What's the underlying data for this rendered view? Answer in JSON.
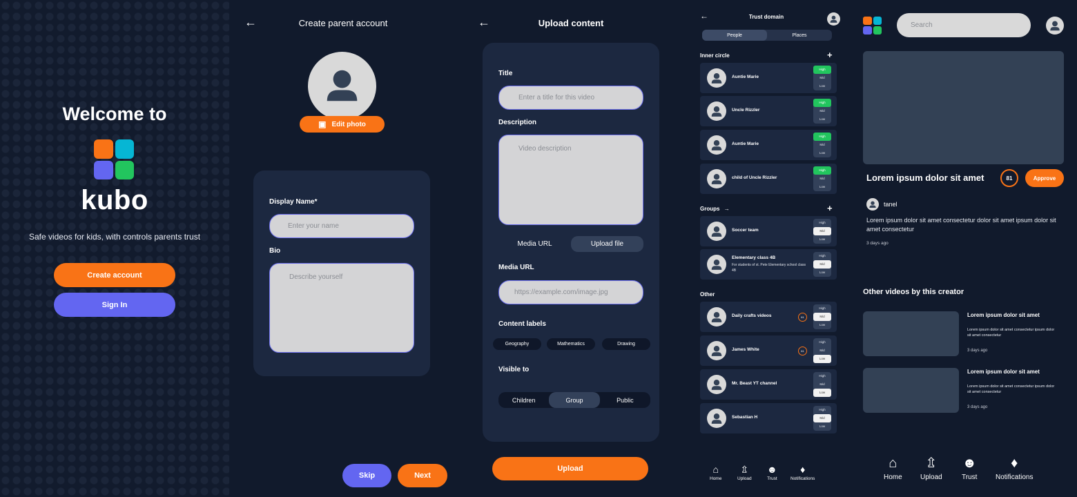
{
  "colors": {
    "bg": "#111a2c",
    "card": "#1c2840",
    "orange": "#f97316",
    "purple": "#6366f1",
    "green": "#22c55e",
    "slate": "#334155"
  },
  "logo_colors": [
    "#f97316",
    "#06b6d4",
    "#6366f1",
    "#22c55e"
  ],
  "welcome": {
    "heading": "Welcome to",
    "brand": "kubo",
    "tagline": "Safe videos for kids, with controls parents trust",
    "create_button": "Create account",
    "signin_button": "Sign In"
  },
  "create_account": {
    "title": "Create parent account",
    "edit_photo": "Edit photo",
    "display_name_label": "Display Name*",
    "display_name_placeholder": "Enter your name",
    "bio_label": "Bio",
    "bio_placeholder": "Describe yourself",
    "skip_button": "Skip",
    "next_button": "Next"
  },
  "upload": {
    "title": "Upload content",
    "title_label": "Title",
    "title_placeholder": "Enter a title for this video",
    "description_label": "Description",
    "description_placeholder": "Video description",
    "source_tabs": [
      "Media URL",
      "Upload file"
    ],
    "media_url_label": "Media URL",
    "media_url_placeholder": "https://example.com/image.jpg",
    "content_labels_label": "Content labels",
    "content_labels": [
      "Geography",
      "Mathematics",
      "Drawing"
    ],
    "visible_to_label": "Visible to",
    "visible_options": [
      "Children",
      "Group",
      "Public"
    ],
    "upload_button": "Upload"
  },
  "trust": {
    "title": "Trust domain",
    "tabs": [
      "People",
      "Places"
    ],
    "inner_circle_label": "Inner circle",
    "groups_label": "Groups",
    "other_label": "Other",
    "levels": [
      "High",
      "Mid",
      "Low"
    ],
    "inner_circle": [
      {
        "name": "Auntie Marie"
      },
      {
        "name": "Uncle Rizzler"
      },
      {
        "name": "Auntie Marie"
      },
      {
        "name": "child of Uncle Rizzler"
      }
    ],
    "groups": [
      {
        "name": "Soccer team"
      },
      {
        "name": "Elementary class 4B",
        "desc": "For students of st. Pete Elementary school class 4B"
      }
    ],
    "other": [
      {
        "name": "Daily crafts videos",
        "score": "61"
      },
      {
        "name": "James White",
        "score": "61"
      },
      {
        "name": "Mr. Beast YT channel"
      },
      {
        "name": "Sebastian H"
      }
    ],
    "nav": [
      "Home",
      "Upload",
      "Trust",
      "Notifications"
    ]
  },
  "video": {
    "search_placeholder": "Search",
    "title": "Lorem ipsum dolor sit amet",
    "score": "81",
    "approve_button": "Approve",
    "creator": "tanel",
    "description": "Lorem ipsum dolor sit amet consectetur dolor sit amet ipsum dolor sit amet consectetur",
    "posted": "3 days ago",
    "other_heading": "Other videos by this creator",
    "other_videos": [
      {
        "title": "Lorem ipsum dolor sit amet",
        "desc": "Lorem ipsum dolor sit amet consectetur ipsum dolor sit amet consectetur",
        "posted": "3 days ago"
      },
      {
        "title": "Lorem ipsum dolor sit amet",
        "desc": "Lorem ipsum dolor sit amet consectetur ipsum dolor sit amet consectetur",
        "posted": "3 days ago"
      }
    ],
    "nav": [
      "Home",
      "Upload",
      "Trust",
      "Notifications"
    ]
  }
}
